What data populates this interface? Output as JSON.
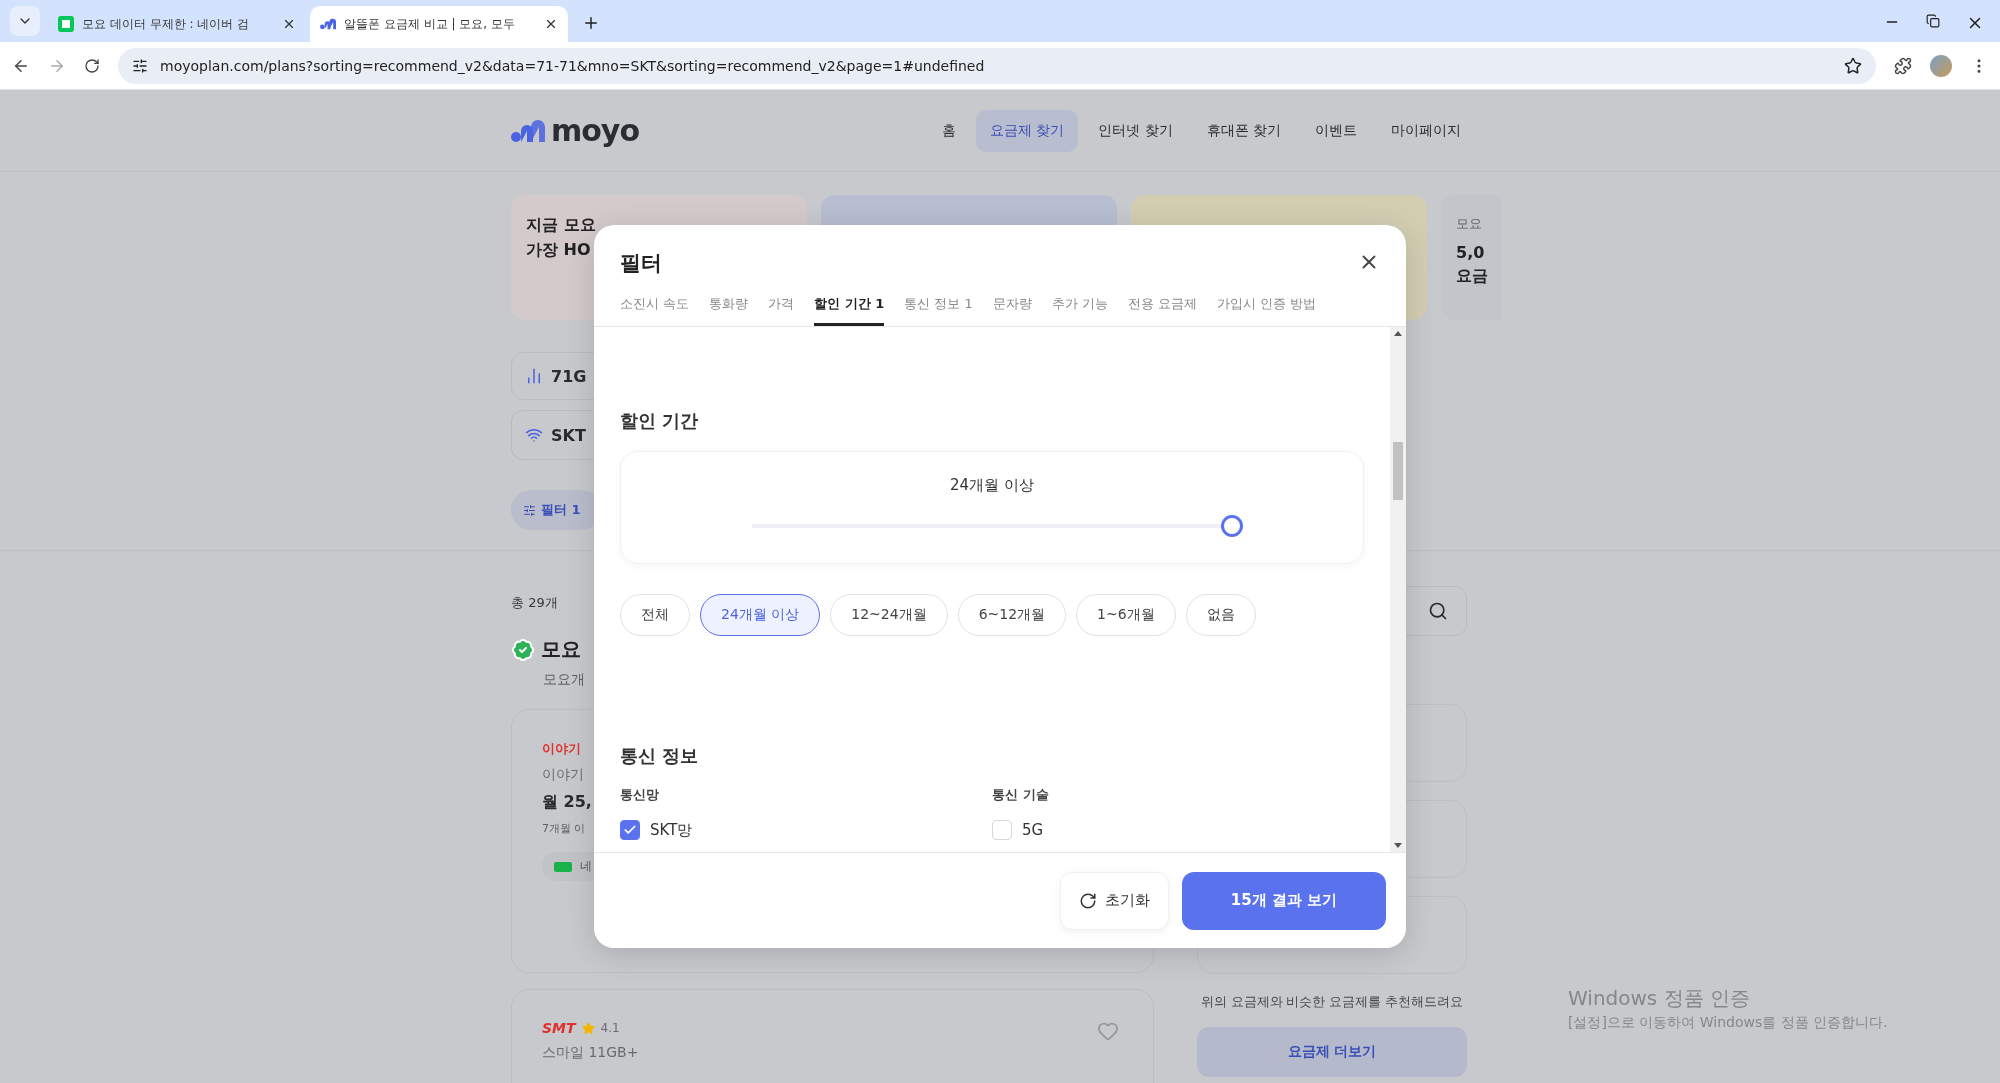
{
  "browser": {
    "tabs": [
      {
        "title": "모요 데이터 무제한 : 네이버 검",
        "selected": false
      },
      {
        "title": "알뜰폰 요금제 비교 | 모요, 모두",
        "selected": true
      }
    ],
    "url": "moyoplan.com/plans?sorting=recommend_v2&data=71-71&mno=SKT&sorting=recommend_v2&page=1#undefined"
  },
  "site": {
    "logo": "moyo",
    "nav": [
      {
        "label": "홈",
        "selected": false
      },
      {
        "label": "요금제 찾기",
        "selected": true
      },
      {
        "label": "인터넷 찾기",
        "selected": false
      },
      {
        "label": "휴대폰 찾기",
        "selected": false
      },
      {
        "label": "이벤트",
        "selected": false
      },
      {
        "label": "마이페이지",
        "selected": false
      }
    ]
  },
  "banners": [
    {
      "color": "#d5cacb",
      "lines": [
        "지금 모요",
        "가장 HO"
      ]
    },
    {
      "color": "#b8bed2"
    },
    {
      "color": "#d3ceb2"
    },
    {
      "color": "#c2c5ca",
      "caption": "모요",
      "lines": [
        "5,0",
        "요금"
      ]
    }
  ],
  "quick_filters": [
    {
      "kind": "data",
      "label": "71G"
    },
    {
      "kind": "network",
      "label": "SKT"
    }
  ],
  "filter_button": "필터 1",
  "results": {
    "total": "총 29개",
    "section_title": "모요",
    "section_subtitle": "모요개"
  },
  "plans": [
    {
      "brand": "이야기",
      "name": "이야기",
      "price": "월 25,",
      "note": "7개월 이",
      "badge": "네"
    },
    {
      "brand": "SMT",
      "rating": "4.1",
      "name": "스마일 11GB+",
      "favorite": false
    }
  ],
  "recommend": {
    "text": "위의 요금제와 비슷한 요금제를 추천해드려요",
    "button": "요금제 더보기"
  },
  "windows_notice": {
    "title": "Windows 정품 인증",
    "text": "[설정]으로 이동하여 Windows를 정품 인증합니다."
  },
  "filter_modal": {
    "title": "필터",
    "tabs": [
      {
        "label": "소진시 속도",
        "selected": false
      },
      {
        "label": "통화량",
        "selected": false
      },
      {
        "label": "가격",
        "selected": false
      },
      {
        "label": "할인 기간 1",
        "selected": true
      },
      {
        "label": "통신 정보 1",
        "selected": false
      },
      {
        "label": "문자량",
        "selected": false
      },
      {
        "label": "추가 기능",
        "selected": false
      },
      {
        "label": "전용 요금제",
        "selected": false
      },
      {
        "label": "가입시 인증 방법",
        "selected": false
      }
    ],
    "sections": [
      {
        "kind": "slider",
        "title": "할인 기간",
        "reading": "24개월 이상",
        "level": 1,
        "options": [
          {
            "label": "전체",
            "selected": false
          },
          {
            "label": "24개월 이상",
            "selected": true
          },
          {
            "label": "12~24개월",
            "selected": false
          },
          {
            "label": "6~12개월",
            "selected": false
          },
          {
            "label": "1~6개월",
            "selected": false
          },
          {
            "label": "없음",
            "selected": false
          }
        ]
      },
      {
        "kind": "checks",
        "title": "통신 정보",
        "groups": [
          {
            "label": "통신망",
            "options": [
              {
                "label": "SKT망",
                "checked": true
              }
            ]
          },
          {
            "label": "통신 기술",
            "options": [
              {
                "label": "5G",
                "checked": false
              }
            ]
          }
        ]
      }
    ],
    "reset": "초기화",
    "apply": "15개 결과 보기"
  }
}
